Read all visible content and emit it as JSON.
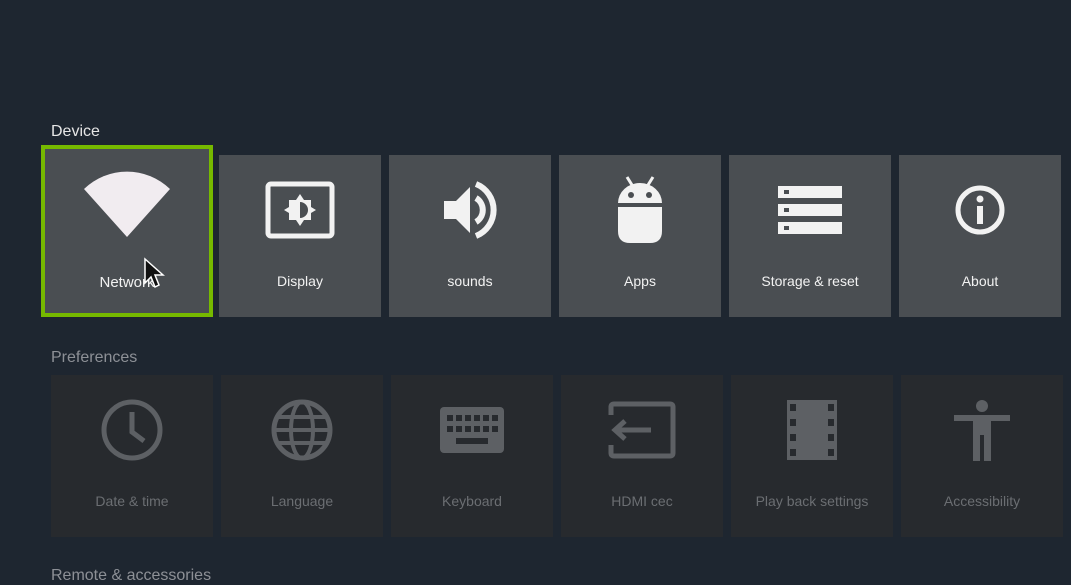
{
  "sections": {
    "device": "Device",
    "preferences": "Preferences",
    "remote": "Remote & accessories"
  },
  "device_tiles": [
    {
      "label": "Network",
      "icon": "wifi-icon",
      "focused": true
    },
    {
      "label": "Display",
      "icon": "display-icon"
    },
    {
      "label": "sounds",
      "icon": "volume-icon"
    },
    {
      "label": "Apps",
      "icon": "android-icon"
    },
    {
      "label": "Storage & reset",
      "icon": "storage-icon"
    },
    {
      "label": "About",
      "icon": "info-icon"
    }
  ],
  "preference_tiles": [
    {
      "label": "Date & time",
      "icon": "clock-icon"
    },
    {
      "label": "Language",
      "icon": "globe-icon"
    },
    {
      "label": "Keyboard",
      "icon": "keyboard-icon"
    },
    {
      "label": "HDMI cec",
      "icon": "input-icon"
    },
    {
      "label": "Play back settings",
      "icon": "film-icon"
    },
    {
      "label": "Accessibility",
      "icon": "accessibility-icon"
    }
  ],
  "colors": {
    "background": "#1e2630",
    "tile": "#4a4e52",
    "tile_dim": "#272a2e",
    "focus_outline": "#76b900"
  }
}
